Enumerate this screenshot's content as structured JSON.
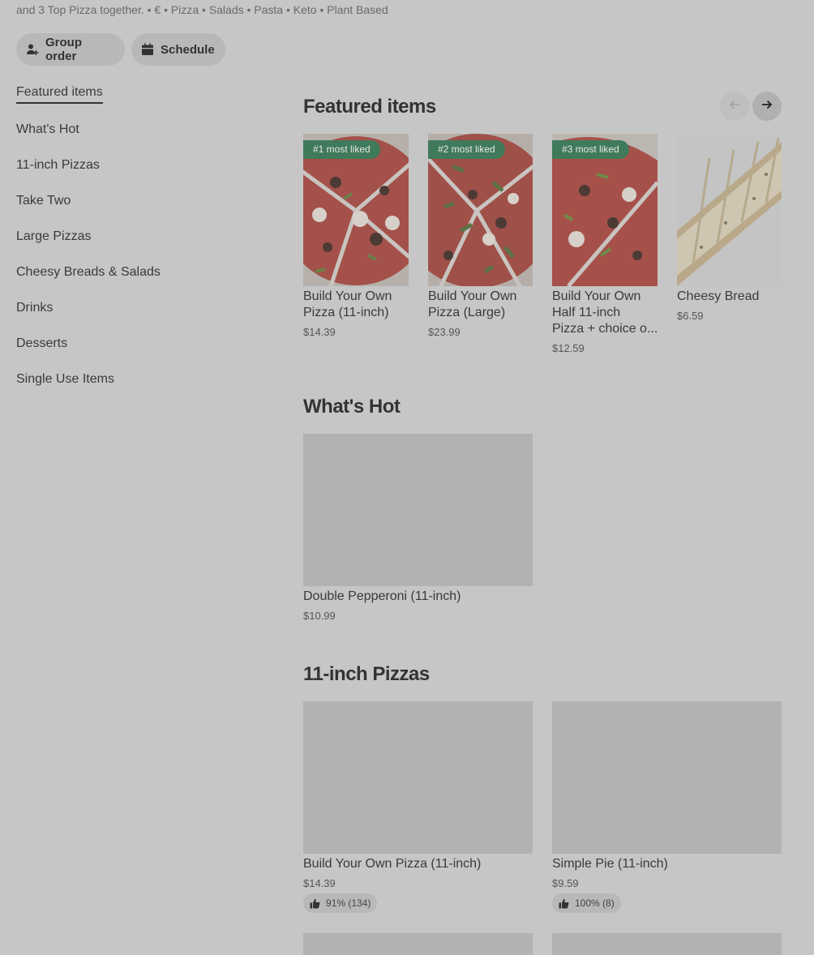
{
  "header": {
    "subtitle": "and 3 Top Pizza together. • € • Pizza • Salads • Pasta • Keto • Plant Based",
    "group_order_label": "Group order",
    "schedule_label": "Schedule"
  },
  "sidebar": {
    "items": [
      {
        "label": "Featured items"
      },
      {
        "label": "What's Hot"
      },
      {
        "label": "11-inch Pizzas"
      },
      {
        "label": "Take Two"
      },
      {
        "label": "Large Pizzas"
      },
      {
        "label": "Cheesy Breads & Salads"
      },
      {
        "label": "Drinks"
      },
      {
        "label": "Desserts"
      },
      {
        "label": "Single Use Items"
      }
    ]
  },
  "featured": {
    "title": "Featured items",
    "items": [
      {
        "badge": "#1 most liked",
        "name_line1": "Build Your Own",
        "name_line2": "Pizza (11-inch)",
        "name_line3": "",
        "price": "$14.39",
        "image_icon": "pizza-image"
      },
      {
        "badge": "#2 most liked",
        "name_line1": "Build Your Own",
        "name_line2": "Pizza (Large)",
        "name_line3": "",
        "price": "$23.99",
        "image_icon": "pizza-image"
      },
      {
        "badge": "#3 most liked",
        "name_line1": "Build Your Own",
        "name_line2": "Half 11-inch",
        "name_line3": "Pizza + choice o...",
        "price": "$12.59",
        "image_icon": "pizza-image"
      },
      {
        "badge": "",
        "name_line1": "Cheesy Bread",
        "name_line2": "",
        "name_line3": "",
        "price": "$6.59",
        "image_icon": "cheesy-bread-image"
      }
    ]
  },
  "whats_hot": {
    "title": "What's Hot",
    "items": [
      {
        "name": "Double Pepperoni (11-inch)",
        "price": "$10.99"
      }
    ]
  },
  "eleven_inch": {
    "title": "11-inch Pizzas",
    "items": [
      {
        "name": "Build Your Own Pizza (11-inch)",
        "price": "$14.39",
        "rating": "91% (134)"
      },
      {
        "name": "Simple Pie (11-inch)",
        "price": "$9.59",
        "rating": "100% (8)"
      }
    ]
  },
  "colors": {
    "background": "#c6c6c6",
    "badge": "#3f7a5a",
    "placeholder": "#b2b2b2"
  }
}
